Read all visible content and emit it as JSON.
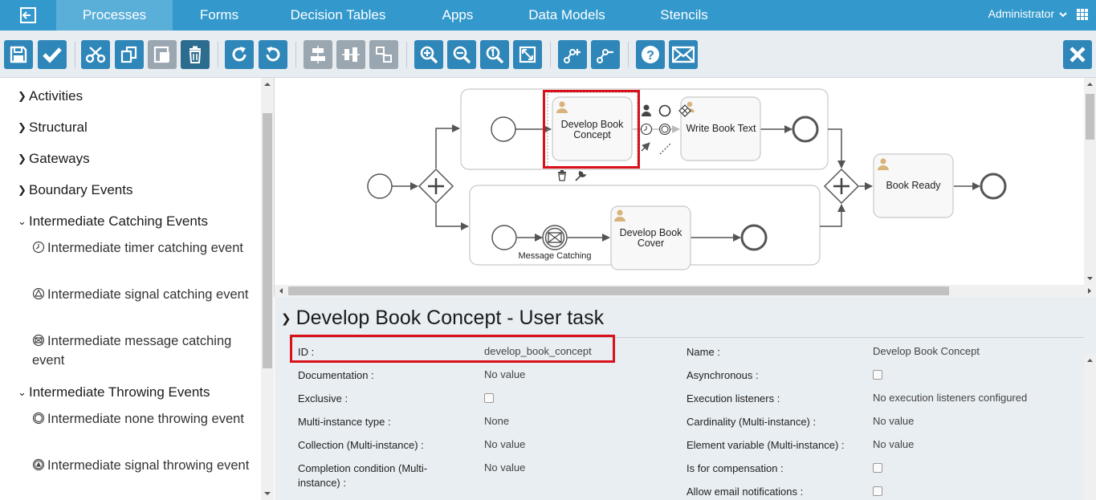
{
  "nav": {
    "tabs": [
      "Processes",
      "Forms",
      "Decision Tables",
      "Apps",
      "Data Models",
      "Stencils"
    ],
    "user": "Administrator"
  },
  "toolbar": {
    "buttons": [
      "save-icon",
      "validate-icon",
      "cut-icon",
      "copy-icon",
      "paste-icon",
      "delete-icon",
      "redo-icon",
      "undo-icon",
      "align-horizontal-icon",
      "align-vertical-icon",
      "same-size-icon",
      "zoom-in-icon",
      "zoom-out-icon",
      "zoom-actual-icon",
      "zoom-fit-icon",
      "add-bendpoint-icon",
      "remove-bendpoint-icon",
      "help-icon",
      "email-icon",
      "close-icon"
    ]
  },
  "palette": {
    "groups": [
      {
        "label": "Activities",
        "expanded": false
      },
      {
        "label": "Structural",
        "expanded": false
      },
      {
        "label": "Gateways",
        "expanded": false
      },
      {
        "label": "Boundary Events",
        "expanded": false
      },
      {
        "label": "Intermediate Catching Events",
        "expanded": true
      },
      {
        "label": "Intermediate Throwing Events",
        "expanded": true
      }
    ],
    "catching_items": [
      {
        "icon": "timer-icon",
        "label": "Intermediate timer catching event"
      },
      {
        "icon": "signal-icon",
        "label": "Intermediate signal catching event"
      },
      {
        "icon": "message-icon",
        "label": "Intermediate message catching event"
      }
    ],
    "throwing_items": [
      {
        "icon": "none-event-icon",
        "label": "Intermediate none throwing event"
      },
      {
        "icon": "signal-throw-icon",
        "label": "Intermediate signal throwing event"
      }
    ]
  },
  "diagram": {
    "task_concept": "Develop Book Concept",
    "task_write": "Write Book Text",
    "task_ready": "Book Ready",
    "task_cover": "Develop Book Cover",
    "message_label": "Message Catching"
  },
  "properties": {
    "title": "Develop Book Concept - User task",
    "left": [
      {
        "label": "ID :",
        "value": "develop_book_concept"
      },
      {
        "label": "Documentation :",
        "value": "No value"
      },
      {
        "label": "Exclusive :",
        "value": ""
      },
      {
        "label": "Multi-instance type :",
        "value": "None"
      },
      {
        "label": "Collection (Multi-instance) :",
        "value": "No value"
      },
      {
        "label": "Completion condition (Multi-instance) :",
        "value": "No value"
      }
    ],
    "right": [
      {
        "label": "Name :",
        "value": "Develop Book Concept"
      },
      {
        "label": "Asynchronous :",
        "value": ""
      },
      {
        "label": "Execution listeners :",
        "value": "No execution listeners configured"
      },
      {
        "label": "Cardinality (Multi-instance) :",
        "value": "No value"
      },
      {
        "label": "Element variable (Multi-instance) :",
        "value": "No value"
      },
      {
        "label": "Is for compensation :",
        "value": ""
      },
      {
        "label": "Allow email notifications :",
        "value": ""
      }
    ]
  },
  "colors": {
    "nav": "#3399cc",
    "toolbar_button": "#2e86b9",
    "highlight": "#d9111a"
  }
}
